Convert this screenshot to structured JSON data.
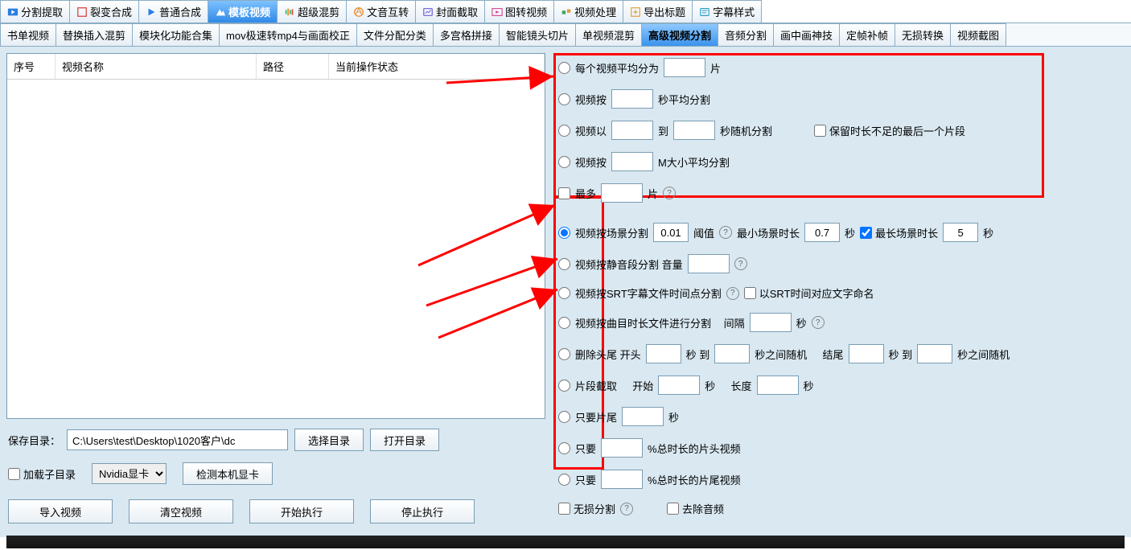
{
  "topTabs": {
    "seg": "分割提取",
    "lb": "裂变合成",
    "pt": "普通合成",
    "mb": "模板视频",
    "cj": "超级混剪",
    "wy": "文音互转",
    "fm": "封面截取",
    "tz": "图转视频",
    "sp": "视频处理",
    "dc": "导出标题",
    "zm": "字幕样式"
  },
  "subTabs": {
    "t0": "书单视频",
    "t1": "替换插入混剪",
    "t2": "模块化功能合集",
    "t3": "mov极速转mp4与画面校正",
    "t4": "文件分配分类",
    "t5": "多宫格拼接",
    "t6": "智能镜头切片",
    "t7": "单视频混剪",
    "t8": "高级视频分割",
    "t9": "音频分割",
    "t10": "画中画神技",
    "t11": "定帧补帧",
    "t12": "无损转换",
    "t13": "视频截图"
  },
  "tbl": {
    "c0": "序号",
    "c1": "视频名称",
    "c2": "路径",
    "c3": "当前操作状态"
  },
  "left": {
    "saveDirLbl": "保存目录：",
    "saveDir": "C:\\Users\\test\\Desktop\\1020客户\\dc",
    "browse": "选择目录",
    "openDir": "打开目录",
    "loadSub": "加载子目录",
    "gpu": "Nvidia显卡",
    "detectGpu": "检测本机显卡",
    "import": "导入视频",
    "clear": "清空视频",
    "start": "开始执行",
    "stop": "停止执行"
  },
  "opt": {
    "r1a": "每个视频平均分为",
    "r1b": "片",
    "r2a": "视频按",
    "r2b": "秒平均分割",
    "r3a": "视频以",
    "r3b": "到",
    "r3c": "秒随机分割",
    "r3chk": "保留时长不足的最后一个片段",
    "r4a": "视频按",
    "r4b": "M大小平均分割",
    "r5a": "最多",
    "r5b": "片",
    "r6a": "视频按场景分割",
    "r6v": "0.01",
    "r6b": "阈值",
    "r6c": "最小场景时长",
    "r6d": "0.7",
    "r6e": "秒",
    "r6f": "最长场景时长",
    "r6g": "5",
    "r6h": "秒",
    "r7a": "视频按静音段分割 音量",
    "r8a": "视频按SRT字幕文件时间点分割",
    "r8chk": "以SRT时间对应文字命名",
    "r9a": "视频按曲目时长文件进行分割",
    "r9b": "间隔",
    "r9c": "秒",
    "r10a": "删除头尾  开头",
    "r10b": "秒 到",
    "r10c": "秒之间随机",
    "r10d": "结尾",
    "r10e": "秒 到",
    "r10f": "秒之间随机",
    "r11a": "片段截取",
    "r11b": "开始",
    "r11c": "秒",
    "r11d": "长度",
    "r11e": "秒",
    "r12a": "只要片尾",
    "r12b": "秒",
    "r13a": "只要",
    "r13b": "%总时长的片头视频",
    "r14a": "只要",
    "r14b": "%总时长的片尾视频",
    "c1": "无损分割",
    "c2": "去除音频"
  }
}
